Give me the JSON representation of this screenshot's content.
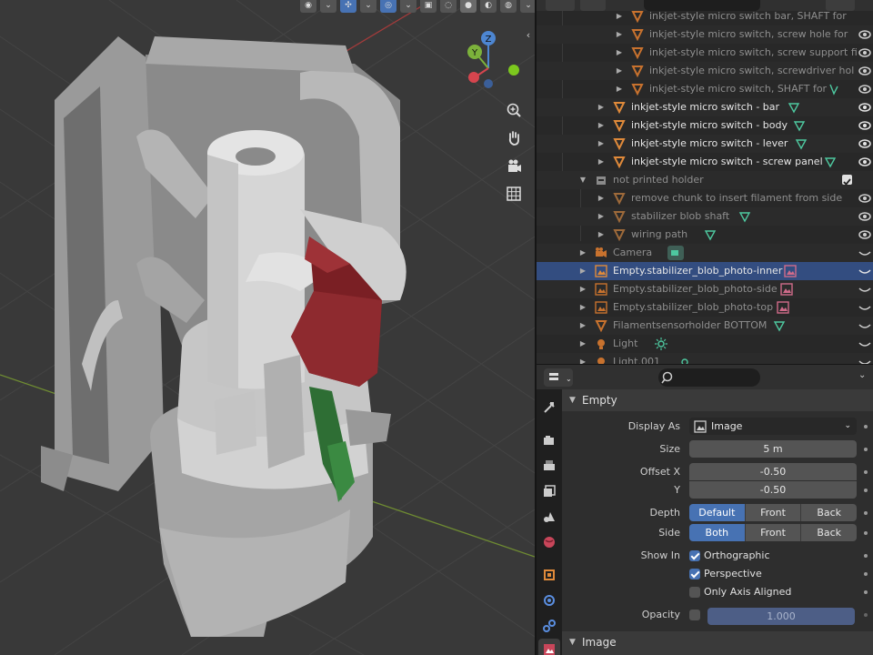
{
  "outliner": {
    "search_placeholder": "",
    "rows": [
      {
        "name": "inkjet-style micro switch bar, SHAFT for",
        "dim": true
      },
      {
        "name": "inkjet-style micro switch, screw hole for",
        "dim": true
      },
      {
        "name": "inkjet-style micro switch, screw support fi",
        "dim": true
      },
      {
        "name": "inkjet-style micro switch, screwdriver hol",
        "dim": true
      },
      {
        "name": "inkjet-style micro switch, SHAFT for",
        "dim": true
      },
      {
        "name": "inkjet-style micro switch - bar",
        "dim": false
      },
      {
        "name": "inkjet-style micro switch - body",
        "dim": false
      },
      {
        "name": "inkjet-style micro switch - lever",
        "dim": false
      },
      {
        "name": "inkjet-style micro switch - screw panel",
        "dim": false
      },
      {
        "name": "not printed holder",
        "dim": true
      },
      {
        "name": "remove chunk to insert filament from side",
        "dim": true
      },
      {
        "name": "stabilizer blob shaft",
        "dim": true
      },
      {
        "name": "wiring path",
        "dim": true
      },
      {
        "name": "Camera",
        "dim": true
      },
      {
        "name": "Empty.stabilizer_blob_photo-inner",
        "dim": true
      },
      {
        "name": "Empty.stabilizer_blob_photo-side",
        "dim": true
      },
      {
        "name": "Empty.stabilizer_blob_photo-top",
        "dim": true
      },
      {
        "name": "Filamentsensorholder BOTTOM",
        "dim": true
      },
      {
        "name": "Light",
        "dim": true
      },
      {
        "name": "Light.001",
        "dim": true
      }
    ]
  },
  "gizmo": {
    "z_label": "Z",
    "y_label": "Y"
  },
  "properties": {
    "search_placeholder": "",
    "empty_panel": {
      "title": "Empty",
      "display_as_label": "Display As",
      "display_as_value": "Image",
      "size_label": "Size",
      "size_value": "5 m",
      "offset_x_label": "Offset X",
      "offset_x_value": "-0.50",
      "offset_y_label": "Y",
      "offset_y_value": "-0.50",
      "depth_label": "Depth",
      "depth_options": [
        "Default",
        "Front",
        "Back"
      ],
      "side_label": "Side",
      "side_options": [
        "Both",
        "Front",
        "Back"
      ],
      "show_in_label": "Show In",
      "orthographic_label": "Orthographic",
      "perspective_label": "Perspective",
      "axis_aligned_label": "Only Axis Aligned",
      "opacity_label": "Opacity",
      "opacity_value": "1.000"
    },
    "image_panel": {
      "title": "Image"
    }
  },
  "colors": {
    "accent": "#4772b3",
    "selected_row": "#334d80",
    "mesh_icon": "#e08a3a",
    "data_icon": "#4ec9a0"
  }
}
